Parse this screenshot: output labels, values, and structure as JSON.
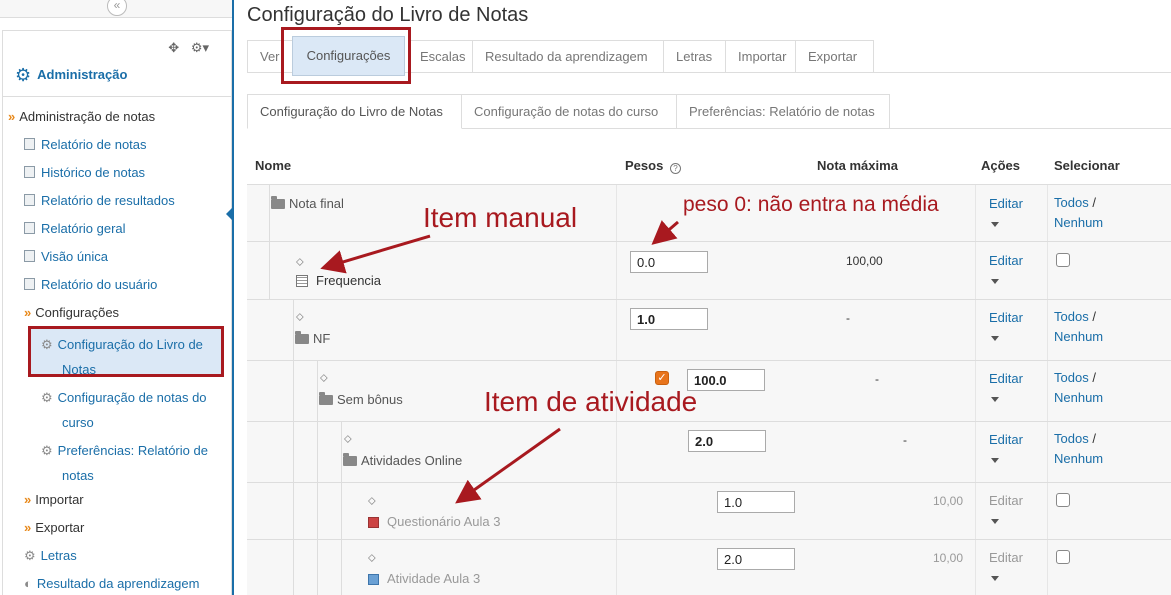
{
  "sidebar": {
    "collapse_glyph": "«",
    "block_controls": {
      "move": "✥",
      "config": "⚙▾"
    },
    "title": "Administração",
    "items": {
      "admin_notas": "Administração de notas",
      "relatorio_notas": "Relatório de notas",
      "historico_notas": "Histórico de notas",
      "relatorio_resultados": "Relatório de resultados",
      "relatorio_geral": "Relatório geral",
      "visao_unica": "Visão única",
      "relatorio_usuario": "Relatório do usuário",
      "configuracoes": "Configurações",
      "conf_livro_1": "Configuração do Livro de",
      "conf_livro_2": "Notas",
      "conf_curso_1": "Configuração de notas do",
      "conf_curso_2": "curso",
      "pref_1": "Preferências: Relatório de",
      "pref_2": "notas",
      "importar": "Importar",
      "exportar": "Exportar",
      "letras": "Letras",
      "resultado_aprendizagem": "Resultado da aprendizagem"
    }
  },
  "main": {
    "title": "Configuração do Livro de Notas",
    "tabs1": [
      "Ver",
      "Configurações",
      "Escalas",
      "Resultado da aprendizagem",
      "Letras",
      "Importar",
      "Exportar"
    ],
    "tabs2": [
      "Configuração do Livro de Notas",
      "Configuração de notas do curso",
      "Preferências: Relatório de notas"
    ],
    "table": {
      "headers": {
        "name": "Nome",
        "weights": "Pesos",
        "max": "Nota máxima",
        "actions": "Ações",
        "select": "Selecionar"
      },
      "edit_label": "Editar",
      "all_label": "Todos",
      "slash": "/",
      "none_label": "Nenhum",
      "rows": {
        "nota_final": {
          "name": "Nota final"
        },
        "frequencia": {
          "name": "Frequencia",
          "weight": "0.0",
          "max": "100,00"
        },
        "nf": {
          "name": "NF",
          "weight": "1.0",
          "max": "-"
        },
        "sem_bonus": {
          "name": "Sem bônus",
          "weight": "100.0",
          "max": "-"
        },
        "atividades_online": {
          "name": "Atividades Online",
          "weight": "2.0",
          "max": "-"
        },
        "questionario": {
          "name": "Questionário Aula 3",
          "weight": "1.0",
          "max": "10,00"
        },
        "atividade": {
          "name": "Atividade Aula 3",
          "weight": "2.0",
          "max": "10,00"
        }
      }
    }
  },
  "annotations": {
    "item_manual": "Item manual",
    "peso_zero": "peso 0: não entra na média",
    "item_atividade": "Item de atividade"
  },
  "colors": {
    "accent": "#1a6ea8",
    "annotation": "#a8191f",
    "checkbox_checked": "#e8741c",
    "selected_bg": "#dbe8f6"
  }
}
